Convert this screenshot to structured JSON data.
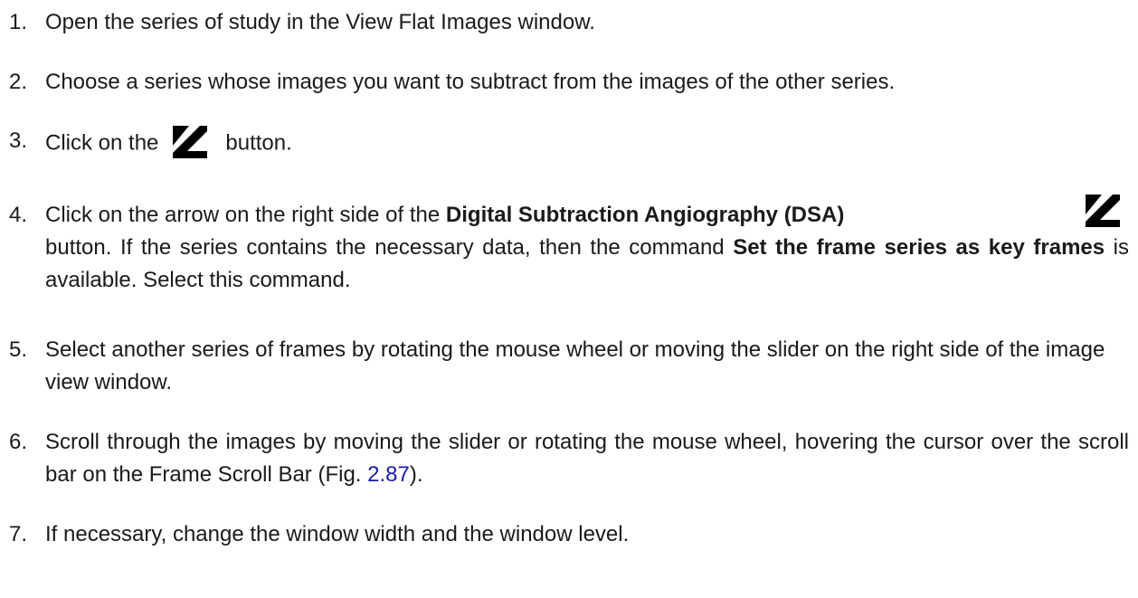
{
  "steps": [
    {
      "num": "1.",
      "text": "Open the series of study in the View Flat Images window."
    },
    {
      "num": "2.",
      "text": "Choose a series whose images you want to subtract from the images of the other series."
    },
    {
      "num": "3.",
      "before": "Click on the",
      "icon": "dsa-icon",
      "after": "button."
    },
    {
      "num": "4.",
      "part1": "Click on the arrow on the right side of the ",
      "bold1": "Digital Subtraction Angiography (DSA)",
      "icon": "dsa-icon",
      "part2": "button.  If the series contains the necessary data, then the command ",
      "bold2": "Set the frame series as key frames",
      "part3": " is available. Select this command."
    },
    {
      "num": "5.",
      "text": "Select another series of frames by rotating the mouse wheel or moving the slider on the right side of the image view window."
    },
    {
      "num": "6.",
      "text": "Scroll through the images by moving the slider or rotating the mouse wheel, hovering the cursor over the scroll bar on the Frame Scroll Bar (Fig. ",
      "ref": "2.87",
      "tail": ")."
    },
    {
      "num": "7.",
      "text": "If necessary, change the window width and the window level."
    }
  ],
  "colors": {
    "text": "#1a1a1a",
    "link": "#1a1ab0",
    "icon": "#000000"
  }
}
